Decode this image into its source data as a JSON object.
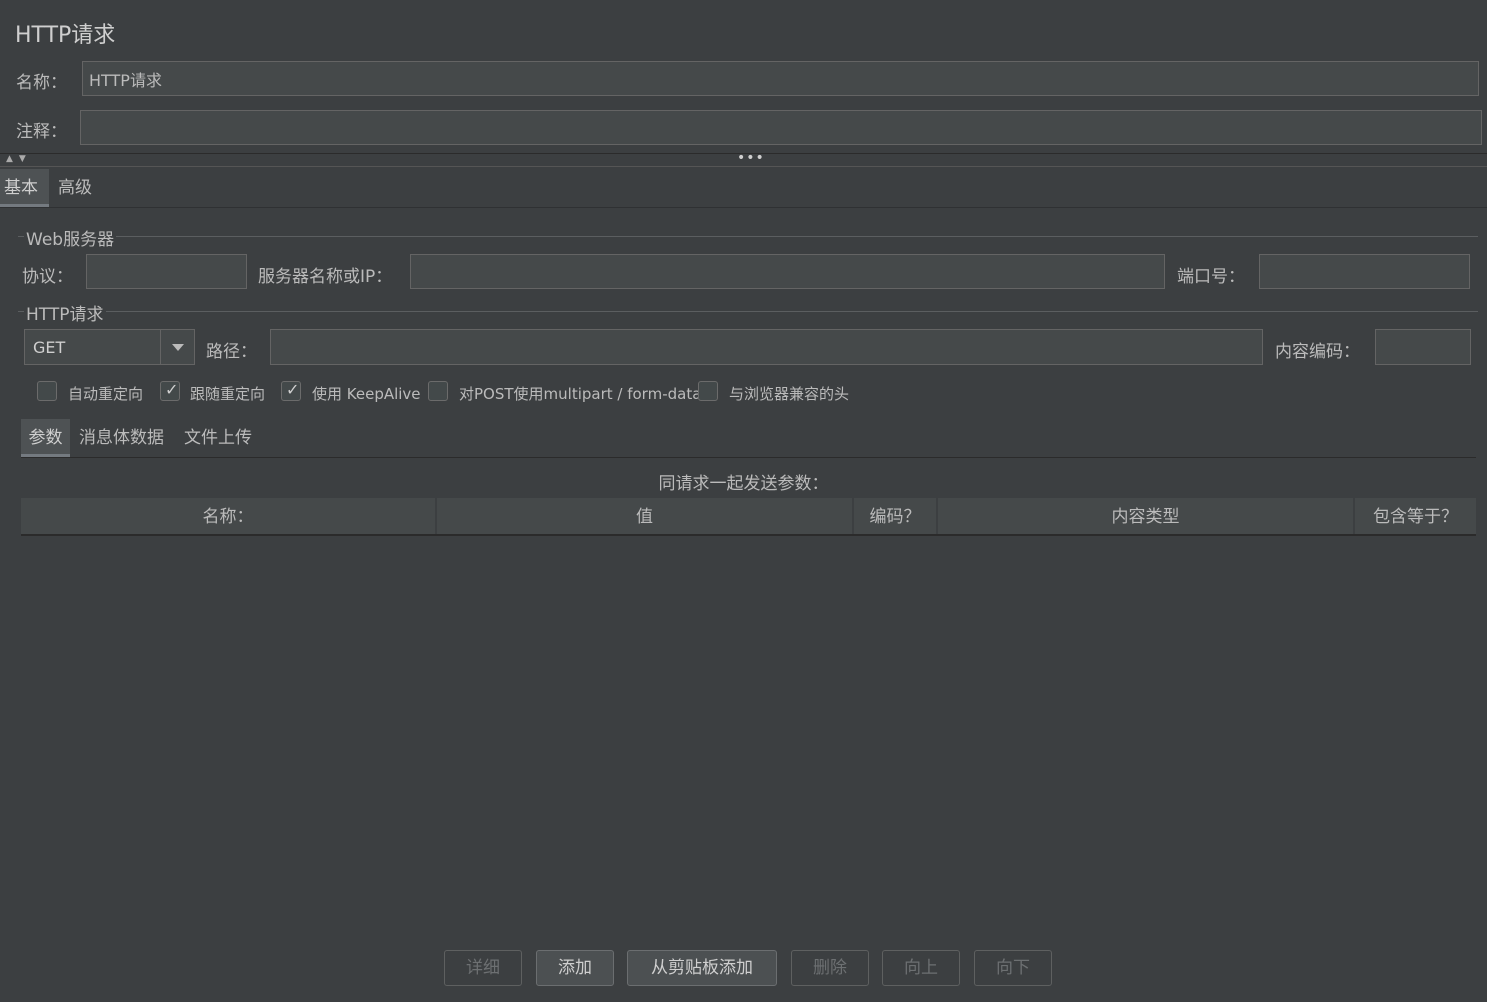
{
  "header": {
    "title": "HTTP请求",
    "name_label": "名称：",
    "name_value": "HTTP请求",
    "comment_label": "注释：",
    "comment_value": ""
  },
  "splitter": {
    "arrows": "▲▼",
    "dots": "•••"
  },
  "main_tabs": [
    {
      "label": "基本",
      "active": true
    },
    {
      "label": "高级",
      "active": false
    }
  ],
  "web_server": {
    "group_title": "Web服务器",
    "protocol_label": "协议：",
    "protocol_value": "",
    "server_label": "服务器名称或IP：",
    "server_value": "",
    "port_label": "端口号：",
    "port_value": ""
  },
  "http_request": {
    "group_title": "HTTP请求",
    "method": "GET",
    "path_label": "路径：",
    "path_value": "",
    "encoding_label": "内容编码：",
    "encoding_value": ""
  },
  "options": [
    {
      "label": "自动重定向",
      "checked": false
    },
    {
      "label": "跟随重定向",
      "checked": true
    },
    {
      "label": "使用 KeepAlive",
      "checked": true
    },
    {
      "label": "对POST使用multipart / form-data",
      "checked": false
    },
    {
      "label": "与浏览器兼容的头",
      "checked": false
    }
  ],
  "sub_tabs": [
    {
      "label": "参数",
      "active": true
    },
    {
      "label": "消息体数据",
      "active": false
    },
    {
      "label": "文件上传",
      "active": false
    }
  ],
  "params": {
    "caption": "同请求一起发送参数：",
    "columns": [
      "名称：",
      "值",
      "编码？",
      "内容类型",
      "包含等于？"
    ],
    "rows": []
  },
  "buttons": [
    {
      "label": "详细",
      "enabled": false
    },
    {
      "label": "添加",
      "enabled": true
    },
    {
      "label": "从剪贴板添加",
      "enabled": true
    },
    {
      "label": "删除",
      "enabled": false
    },
    {
      "label": "向上",
      "enabled": false
    },
    {
      "label": "向下",
      "enabled": false
    }
  ],
  "check_glyph": "✓",
  "colors": {
    "background": "#3c3f41",
    "field": "#45494a",
    "text": "#bbbbbb"
  }
}
